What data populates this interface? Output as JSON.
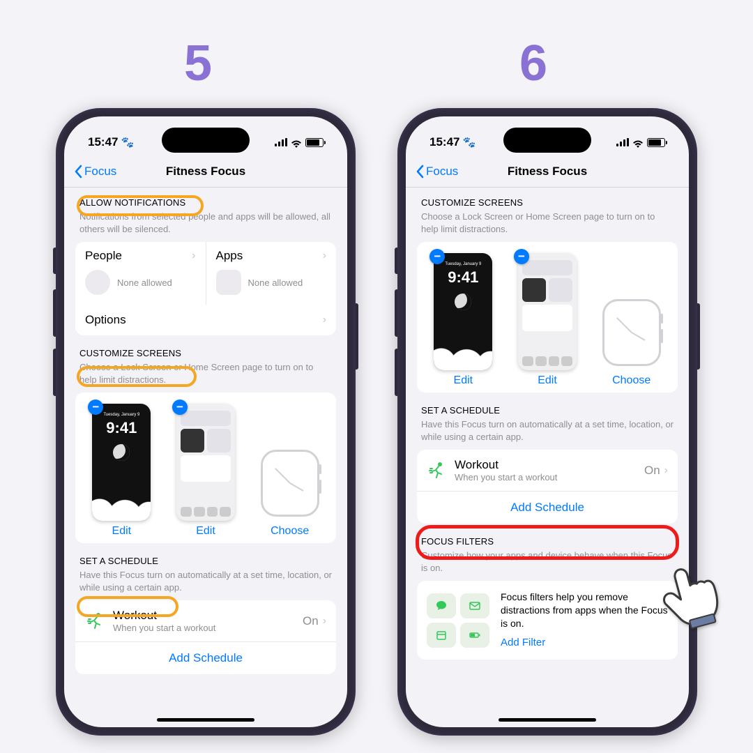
{
  "steps": {
    "five": "5",
    "six": "6"
  },
  "status": {
    "time": "15:47",
    "paw": "🐾"
  },
  "nav": {
    "back": "Focus",
    "title": "Fitness Focus"
  },
  "colors": {
    "accent": "#007aff",
    "highlight": "#f5a623",
    "alert": "#ef1b1b",
    "step": "#8a72d4"
  },
  "allow": {
    "header": "ALLOW NOTIFICATIONS",
    "sub": "Notifications from selected people and apps will be allowed, all others will be silenced.",
    "people": "People",
    "apps": "Apps",
    "none": "None allowed",
    "options": "Options"
  },
  "customize": {
    "header": "CUSTOMIZE SCREENS",
    "sub": "Choose a Lock Screen or Home Screen page to turn on to help limit distractions.",
    "edit": "Edit",
    "choose": "Choose",
    "lock_time": "9:41",
    "lock_date": "Tuesday, January 9"
  },
  "schedule": {
    "header": "SET A SCHEDULE",
    "sub": "Have this Focus turn on automatically at a set time, location, or while using a certain app.",
    "workout": "Workout",
    "workout_sub": "When you start a workout",
    "on": "On",
    "add": "Add Schedule"
  },
  "filters": {
    "header": "FOCUS FILTERS",
    "sub": "Customize how your apps and device behave when this Focus is on.",
    "body": "Focus filters help you remove distractions from apps when the Focus is on.",
    "add": "Add Filter"
  }
}
